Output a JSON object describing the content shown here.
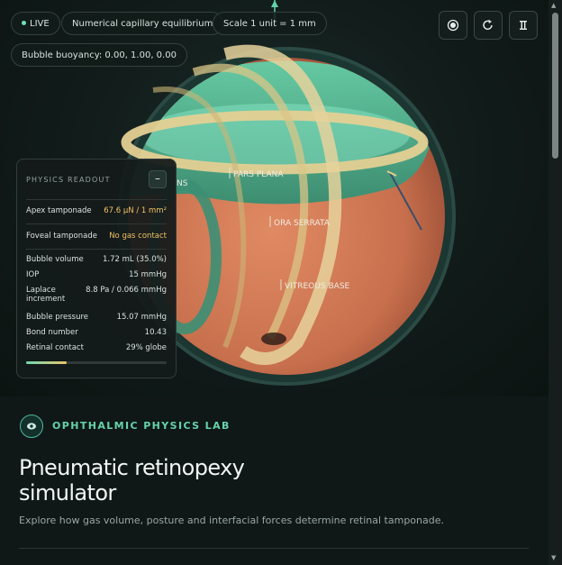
{
  "chips": {
    "live": "LIVE",
    "mode": "Numerical capillary equilibrium",
    "scale": "Scale 1 unit = 1 mm",
    "buoyancy": "Bubble buoyancy: 0.00, 1.00, 0.00"
  },
  "toolbar": {
    "view_icon": "target-icon",
    "reset_icon": "reset-icon",
    "pause_icon": "pause-icon"
  },
  "scene": {
    "labels": {
      "pars_plana": "PARS PLANA",
      "ora_serrata": "ORA SERRATA",
      "vitreous_base": "VITREOUS BASE",
      "partial": "NS"
    },
    "colors": {
      "gas": "#58c9a2",
      "retina": "#cf7450",
      "ring": "#e8d29a"
    }
  },
  "readout": {
    "title": "PHYSICS READOUT",
    "collapse_label": "–",
    "apex": {
      "label": "Apex tamponade",
      "value": "67.6 µN / 1 mm²"
    },
    "foveal": {
      "label": "Foveal tamponade",
      "value": "No gas contact"
    },
    "rows": [
      {
        "label": "Bubble volume",
        "value": "1.72 mL (35.0%)"
      },
      {
        "label": "IOP",
        "value": "15 mmHg"
      },
      {
        "label": "Laplace increment",
        "value": "8.8 Pa / 0.066 mmHg"
      },
      {
        "label": "Bubble pressure",
        "value": "15.07 mmHg"
      },
      {
        "label": "Bond number",
        "value": "10.43"
      },
      {
        "label": "Retinal contact",
        "value": "29% globe"
      }
    ],
    "contact_fraction": 0.29
  },
  "lab": {
    "label": "OPHTHALMIC PHYSICS LAB",
    "title": "Pneumatic retinopexy simulator",
    "subtitle": "Explore how gas volume, posture and interfacial forces determine retinal tamponade."
  }
}
